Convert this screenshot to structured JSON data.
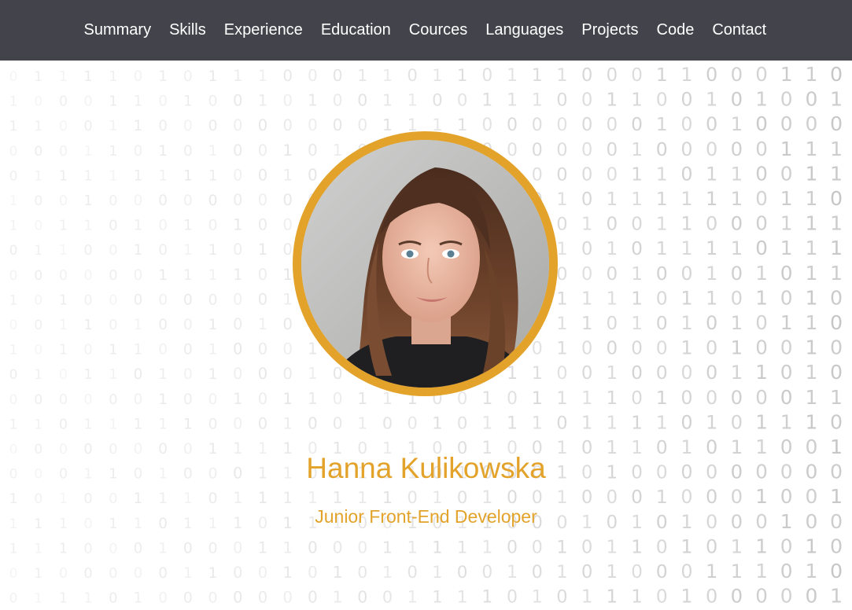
{
  "nav": {
    "items": [
      {
        "label": "Summary"
      },
      {
        "label": "Skills"
      },
      {
        "label": "Experience"
      },
      {
        "label": "Education"
      },
      {
        "label": "Cources"
      },
      {
        "label": "Languages"
      },
      {
        "label": "Projects"
      },
      {
        "label": "Code"
      },
      {
        "label": "Contact"
      }
    ]
  },
  "hero": {
    "name": "Hanna Kulikowska",
    "title": "Junior Front-End Developer",
    "photo_alt": "Hanna Kulikowska"
  },
  "theme": {
    "navbar_bg": "#43434b",
    "nav_text": "#ffffff",
    "accent": "#e3a32a",
    "background": "#ffffff",
    "binary_digit_color": "#9a9a9a"
  },
  "background_pattern": {
    "type": "binary-digits",
    "rows": [
      "0111101011100011011011100011000110000",
      "1000110100101001100111001100101001011",
      "1100110000000001111000000010010000010",
      "0001101010010101110000000100000111101",
      "0111111110010110111110000110110011010",
      "1001000000000111111100101111110110000",
      "1011010101000011101111010011000111000",
      "0110010110101100010110101011110111101",
      "0000001111010111001010000100101011111",
      "1010000000010100000101111101101010010",
      "0011010010101110010101110101010110000",
      "1010110010001111100010100001010010100",
      "0101101010001000010111001000011010110",
      "0000001001011011100101111010000011101",
      "1101111100010010010111011110101110010",
      "0000000011110101100100101101011001101",
      "0001101000110011101000101000000000001",
      "1010011101111111010100100010001001010",
      "1110110111011100101100010101000100000",
      "1110001000110001111100101101011010100",
      "0100000110010101010010101000111010101",
      "0111010000000100111101011101000001110"
    ]
  }
}
